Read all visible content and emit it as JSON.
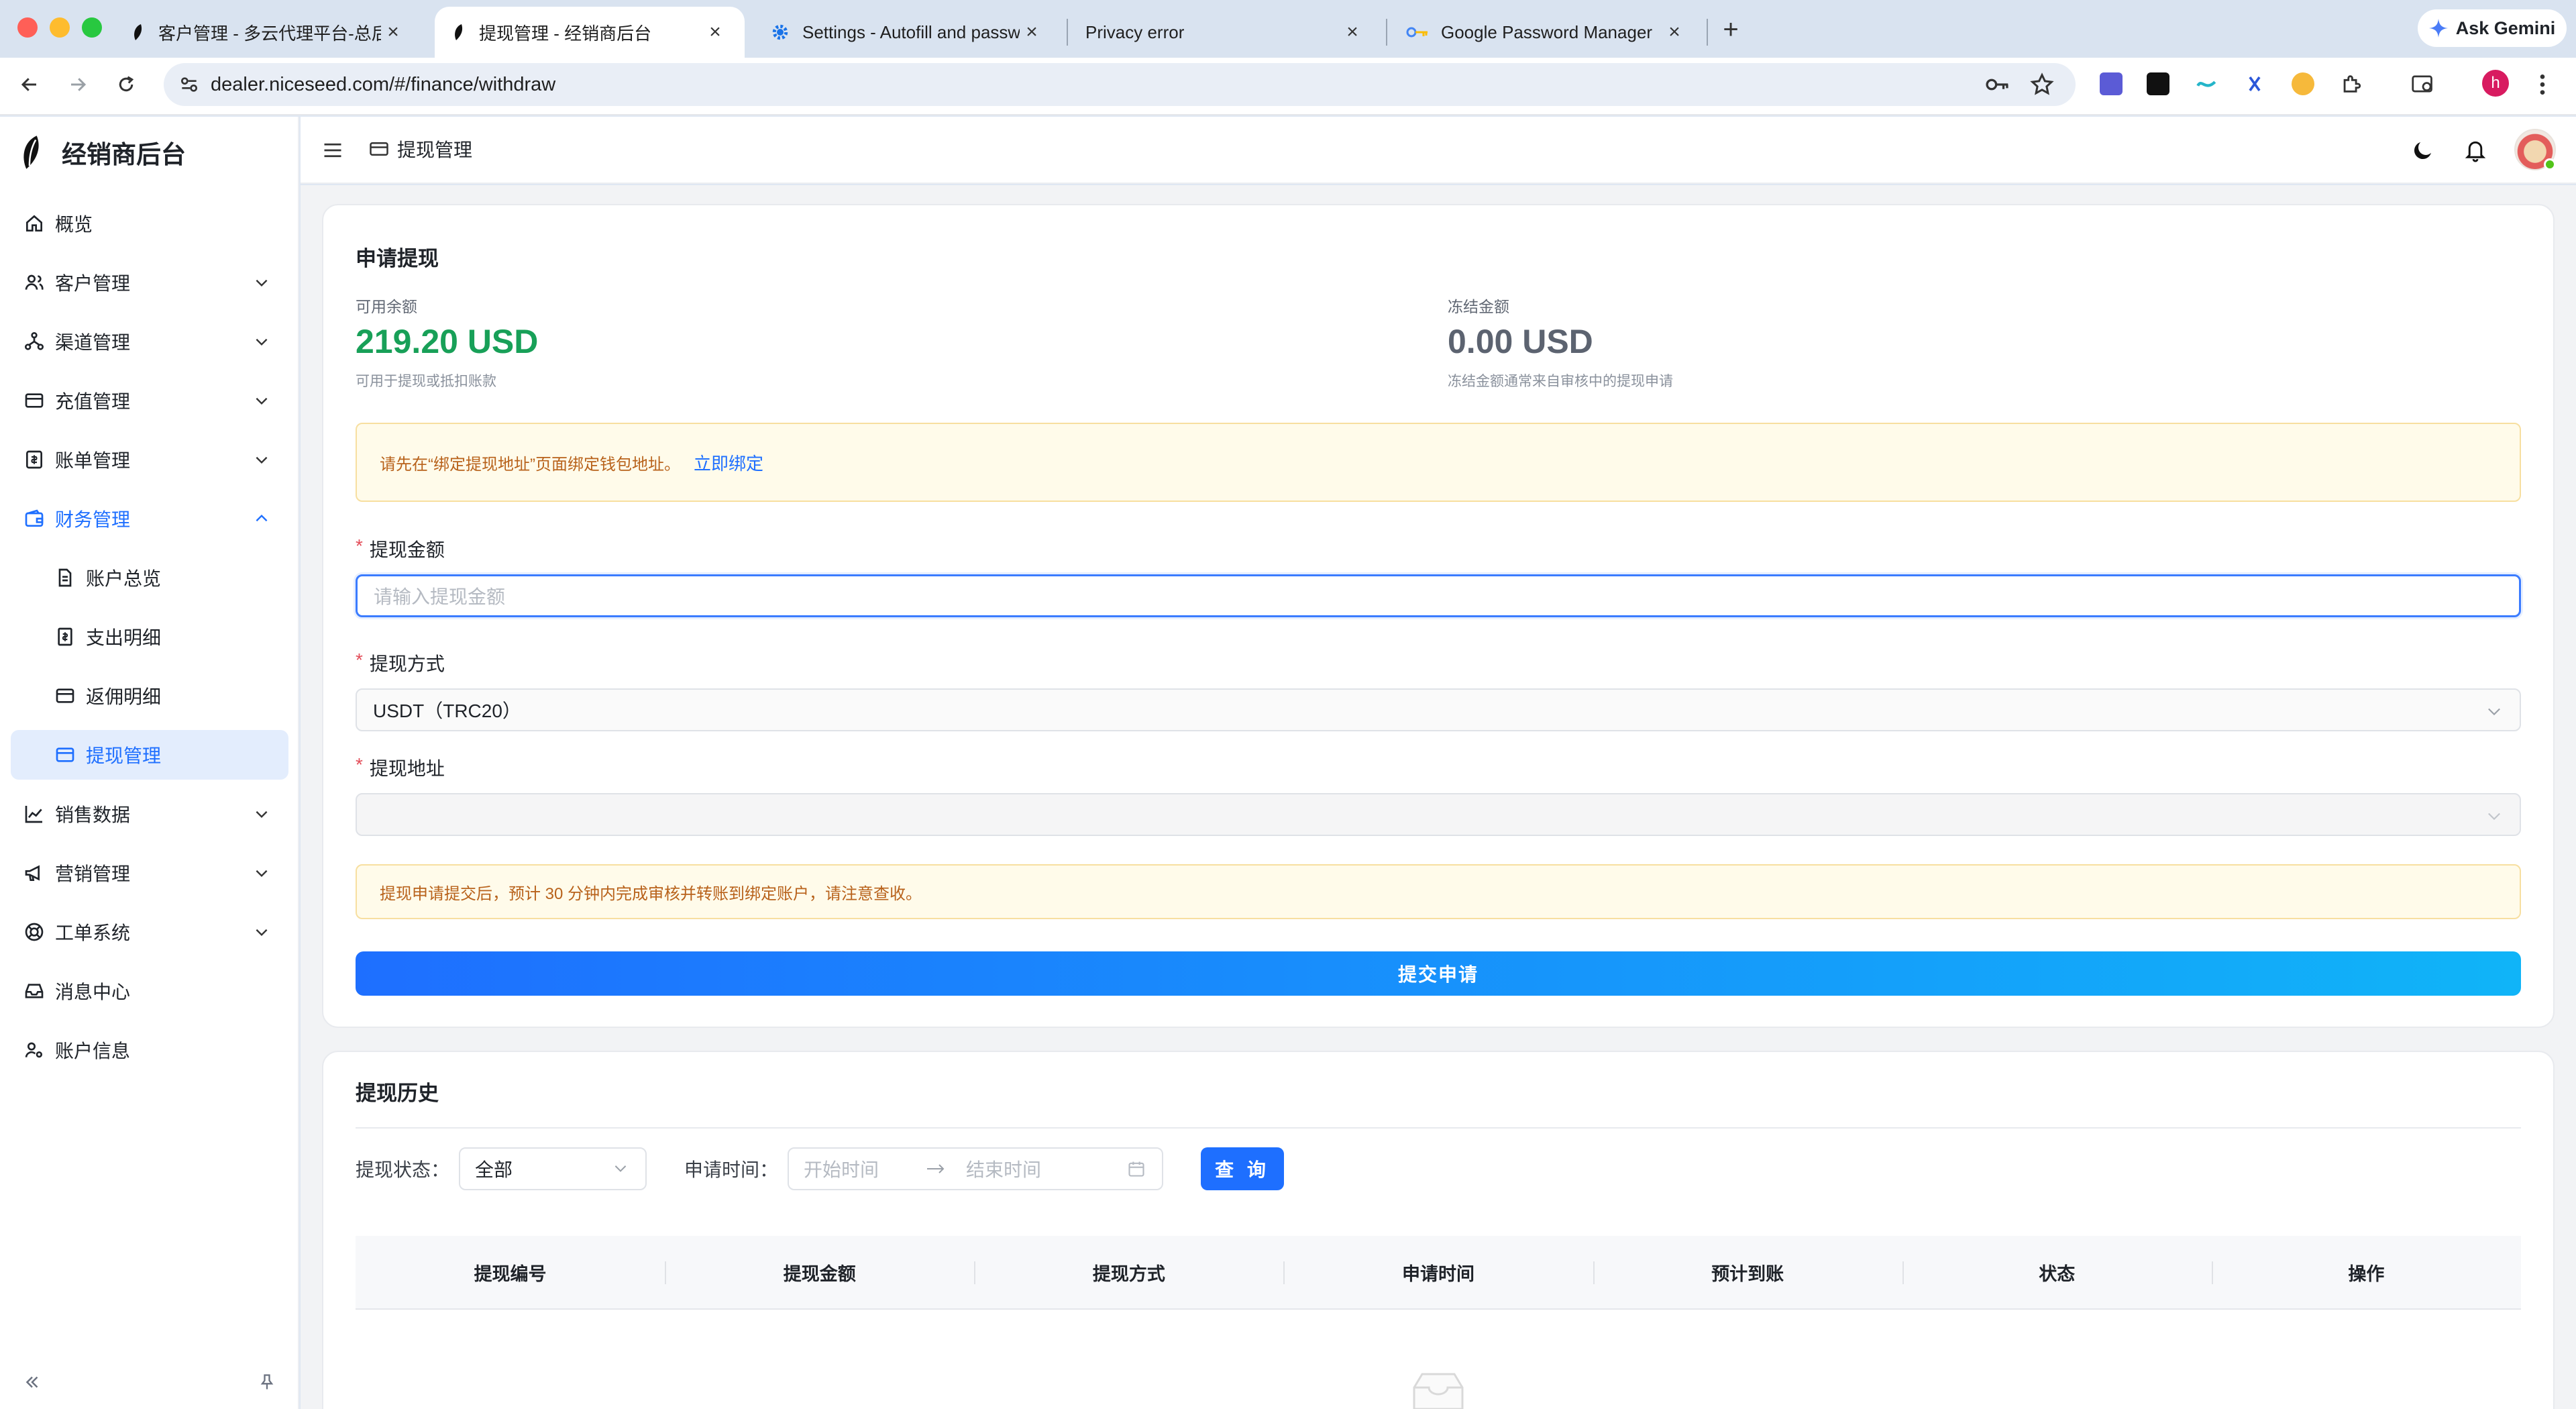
{
  "browser": {
    "tabs": [
      {
        "title": "客户管理 - 多云代理平台-总后台",
        "active": false
      },
      {
        "title": "提现管理 - 经销商后台",
        "active": true
      },
      {
        "title": "Settings - Autofill and passwords",
        "active": false
      },
      {
        "title": "Privacy error",
        "active": false
      },
      {
        "title": "Google Password Manager",
        "active": false
      }
    ],
    "new_tab": "+",
    "ask_gemini": "Ask Gemini",
    "url": "dealer.niceseed.com/#/finance/withdraw",
    "profile_initial": "h"
  },
  "app": {
    "brand": "经销商后台",
    "breadcrumb": "提现管理"
  },
  "sidebar": {
    "items": [
      {
        "label": "概览",
        "icon": "home-icon",
        "expandable": false
      },
      {
        "label": "客户管理",
        "icon": "users-icon",
        "expandable": true
      },
      {
        "label": "渠道管理",
        "icon": "channel-icon",
        "expandable": true
      },
      {
        "label": "充值管理",
        "icon": "card-icon",
        "expandable": true
      },
      {
        "label": "账单管理",
        "icon": "bill-icon",
        "expandable": true
      },
      {
        "label": "财务管理",
        "icon": "wallet-icon",
        "expandable": true,
        "open": true
      },
      {
        "label": "账户总览",
        "icon": "doc-icon",
        "sub": true
      },
      {
        "label": "支出明细",
        "icon": "receipt-icon",
        "sub": true
      },
      {
        "label": "返佣明细",
        "icon": "card-icon",
        "sub": true
      },
      {
        "label": "提现管理",
        "icon": "card-icon",
        "sub": true,
        "selected": true
      },
      {
        "label": "销售数据",
        "icon": "chart-icon",
        "expandable": true
      },
      {
        "label": "营销管理",
        "icon": "megaphone-icon",
        "expandable": true
      },
      {
        "label": "工单系统",
        "icon": "lifebuoy-icon",
        "expandable": true
      },
      {
        "label": "消息中心",
        "icon": "inbox-icon",
        "expandable": false
      },
      {
        "label": "账户信息",
        "icon": "user-gear-icon",
        "expandable": false
      }
    ]
  },
  "apply": {
    "title": "申请提现",
    "available_label": "可用余额",
    "available_value": "219.20 USD",
    "available_hint": "可用于提现或抵扣账款",
    "frozen_label": "冻结金额",
    "frozen_value": "0.00 USD",
    "frozen_hint": "冻结金额通常来自审核中的提现申请",
    "bind_notice": "请先在“绑定提现地址”页面绑定钱包地址。",
    "bind_link": "立即绑定",
    "amount_label": "提现金额",
    "amount_placeholder": "请输入提现金额",
    "method_label": "提现方式",
    "method_value": "USDT（TRC20）",
    "address_label": "提现地址",
    "address_value": "",
    "process_notice": "提现申请提交后，预计 30 分钟内完成审核并转账到绑定账户，请注意查收。",
    "submit_label": "提交申请"
  },
  "history": {
    "title": "提现历史",
    "status_label": "提现状态：",
    "status_value": "全部",
    "time_label": "申请时间：",
    "start_placeholder": "开始时间",
    "end_placeholder": "结束时间",
    "query_label": "查 询",
    "columns": [
      "提现编号",
      "提现金额",
      "提现方式",
      "申请时间",
      "预计到账",
      "状态",
      "操作"
    ]
  },
  "colors": {
    "accent": "#1e6fff",
    "balance_green": "#18a058",
    "warning_text": "#b8621b"
  }
}
